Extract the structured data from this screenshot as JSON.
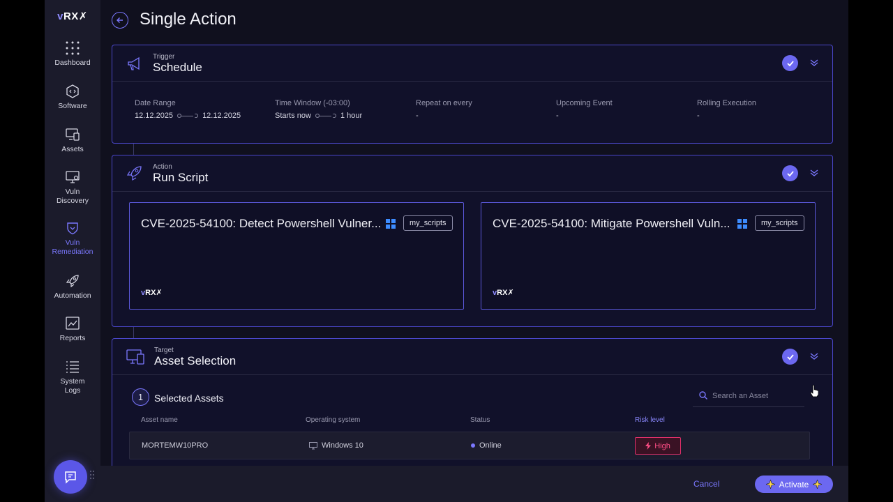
{
  "app": {
    "logo_v": "v",
    "logo_rest": "RX"
  },
  "sidebar": {
    "items": [
      {
        "label": "Dashboard",
        "icon": "dashboard-grid-icon"
      },
      {
        "label": "Software",
        "icon": "software-code-icon"
      },
      {
        "label": "Assets",
        "icon": "assets-monitor-icon"
      },
      {
        "label": "Vuln\nDiscovery",
        "icon": "vuln-discovery-icon"
      },
      {
        "label": "Vuln\nRemediation",
        "icon": "vuln-remediation-shield-icon",
        "active": true
      },
      {
        "label": "Automation",
        "icon": "automation-rocket-icon"
      },
      {
        "label": "Reports",
        "icon": "reports-chart-icon"
      },
      {
        "label": "System\nLogs",
        "icon": "system-logs-list-icon"
      }
    ]
  },
  "page": {
    "title": "Single Action"
  },
  "trigger": {
    "eyebrow": "Trigger",
    "title": "Schedule",
    "columns": [
      {
        "label": "Date Range",
        "start": "12.12.2025",
        "end": "12.12.2025"
      },
      {
        "label": "Time Window (-03:00)",
        "start": "Starts now",
        "end": "1 hour"
      },
      {
        "label": "Repeat on every",
        "value": "-"
      },
      {
        "label": "Upcoming Event",
        "value": "-"
      },
      {
        "label": "Rolling Execution",
        "value": "-"
      }
    ]
  },
  "action": {
    "eyebrow": "Action",
    "title": "Run Script",
    "scripts": [
      {
        "title": "CVE-2025-54100: Detect Powershell Vulner...",
        "tag": "my_scripts",
        "os": "windows-icon"
      },
      {
        "title": "CVE-2025-54100: Mitigate Powershell Vuln...",
        "tag": "my_scripts",
        "os": "windows-icon"
      }
    ]
  },
  "target": {
    "eyebrow": "Target",
    "title": "Asset Selection",
    "selected_count": "1",
    "selected_label": "Selected Assets",
    "search_placeholder": "Search an Asset",
    "columns": [
      "Asset name",
      "Operating system",
      "Status",
      "Risk level"
    ],
    "rows": [
      {
        "asset": "MORTEMW10PRO",
        "os": "Windows 10",
        "status": "Online",
        "risk": "High"
      }
    ]
  },
  "footer": {
    "cancel": "Cancel",
    "activate": "Activate"
  },
  "colors": {
    "accent": "#6c68f0",
    "risk_high": "#ff4d85",
    "background": "#10101e"
  }
}
